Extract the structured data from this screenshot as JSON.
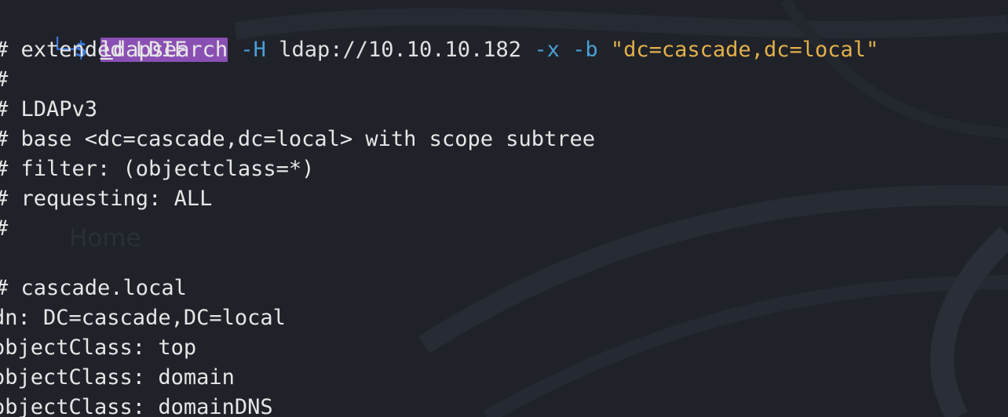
{
  "prompt": {
    "corner": "└─",
    "dollar": "$"
  },
  "command": {
    "first_char": "l",
    "rest": "dapsearch",
    "flag_h": "-H",
    "uri": "ldap://10.10.10.182",
    "flag_x": "-x",
    "flag_b": "-b",
    "base_dn": "\"dc=cascade,dc=local\""
  },
  "background_ghost_text": "Home",
  "output_lines": [
    "# extended LDIF",
    "#",
    "# LDAPv3",
    "# base <dc=cascade,dc=local> with scope subtree",
    "# filter: (objectclass=*)",
    "# requesting: ALL",
    "#",
    "",
    "# cascade.local",
    "dn: DC=cascade,DC=local",
    "objectClass: top",
    "objectClass: domain",
    "objectClass: domainDNS"
  ],
  "colors": {
    "background": "#1f2229",
    "prompt": "#3f7be0",
    "command_highlight": "#8a4fb3",
    "option": "#4a9fd6",
    "string": "#e3b04a",
    "text": "#e6e6e6"
  }
}
